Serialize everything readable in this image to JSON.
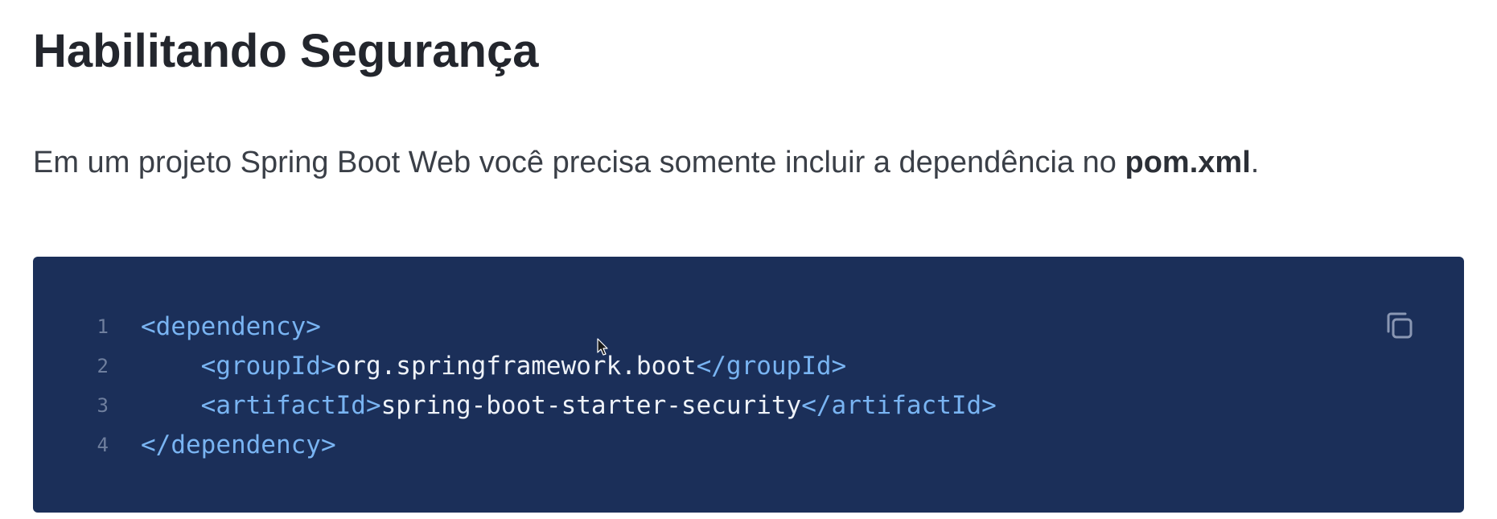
{
  "page": {
    "title": "Habilitando Segurança",
    "intro_text": "Em um projeto Spring Boot Web você precisa somente incluir a dependência no ",
    "intro_bold": "pom.xml",
    "intro_end": "."
  },
  "code_block": {
    "copy_icon": "copy-icon",
    "lines": [
      {
        "number": "1",
        "indent": "",
        "open_tag": "<dependency>",
        "text": "",
        "close_tag": ""
      },
      {
        "number": "2",
        "indent": "    ",
        "open_tag": "<groupId>",
        "text": "org.springframework.boot",
        "close_tag": "</groupId>"
      },
      {
        "number": "3",
        "indent": "    ",
        "open_tag": "<artifactId>",
        "text": "spring-boot-starter-security",
        "close_tag": "</artifactId>"
      },
      {
        "number": "4",
        "indent": "",
        "open_tag": "</dependency>",
        "text": "",
        "close_tag": ""
      }
    ]
  },
  "colors": {
    "code_background": "#1b2f59",
    "tag": "#79b4f2",
    "code_text": "#eef2f8",
    "line_number": "#6f7f9e"
  }
}
